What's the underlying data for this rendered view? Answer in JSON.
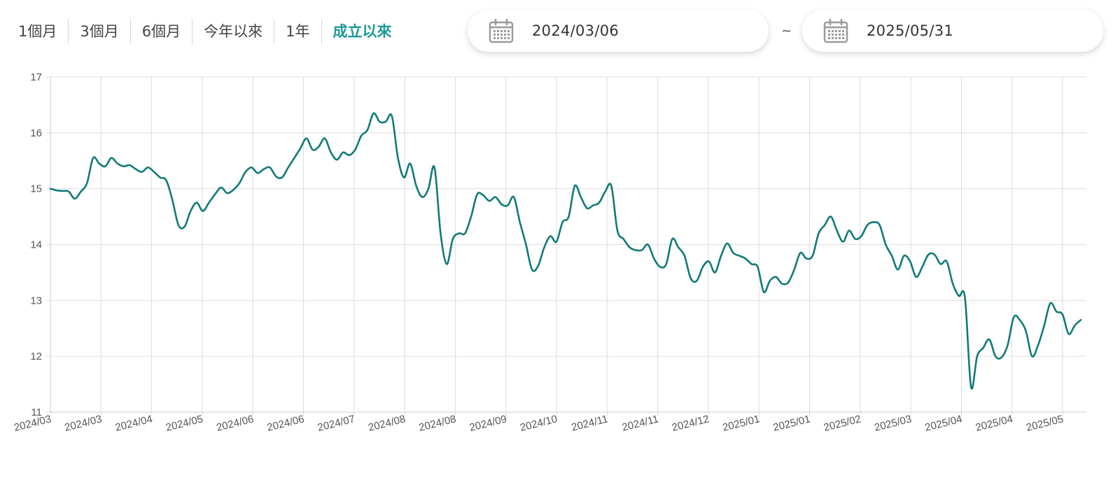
{
  "range_tabs": [
    {
      "label": "1個月",
      "active": false
    },
    {
      "label": "3個月",
      "active": false
    },
    {
      "label": "6個月",
      "active": false
    },
    {
      "label": "今年以來",
      "active": false
    },
    {
      "label": "1年",
      "active": false
    },
    {
      "label": "成立以來",
      "active": true
    }
  ],
  "date_range": {
    "start": "2024/03/06",
    "separator": "~",
    "end": "2025/05/31",
    "icon": "calendar-icon"
  },
  "colors": {
    "accent": "#1a9a97",
    "line": "#117a78",
    "grid": "#dddddd",
    "axis_text": "#555555"
  },
  "chart_data": {
    "type": "line",
    "title": "",
    "xlabel": "",
    "ylabel": "",
    "ylim": [
      11,
      17
    ],
    "yticks": [
      11,
      12,
      13,
      14,
      15,
      16,
      17
    ],
    "grid": true,
    "xtick_labels": [
      "2024/03",
      "2024/03",
      "2024/04",
      "2024/05",
      "2024/06",
      "2024/06",
      "2024/07",
      "2024/08",
      "2024/08",
      "2024/09",
      "2024/10",
      "2024/11",
      "2024/11",
      "2024/12",
      "2025/01",
      "2025/01",
      "2025/02",
      "2025/03",
      "2025/04",
      "2025/04",
      "2025/05"
    ],
    "series": [
      {
        "values": [
          15.0,
          14.97,
          14.96,
          14.95,
          14.82,
          14.95,
          15.1,
          15.55,
          15.45,
          15.4,
          15.55,
          15.45,
          15.4,
          15.42,
          15.35,
          15.3,
          15.38,
          15.3,
          15.2,
          15.15,
          14.8,
          14.35,
          14.32,
          14.6,
          14.75,
          14.6,
          14.75,
          14.9,
          15.02,
          14.92,
          14.98,
          15.1,
          15.3,
          15.38,
          15.28,
          15.35,
          15.38,
          15.22,
          15.2,
          15.38,
          15.55,
          15.72,
          15.9,
          15.7,
          15.75,
          15.9,
          15.65,
          15.52,
          15.65,
          15.6,
          15.7,
          15.95,
          16.05,
          16.35,
          16.2,
          16.2,
          16.3,
          15.55,
          15.2,
          15.45,
          15.05,
          14.85,
          15.0,
          15.38,
          14.2,
          13.65,
          14.1,
          14.2,
          14.2,
          14.5,
          14.9,
          14.88,
          14.78,
          14.85,
          14.72,
          14.7,
          14.85,
          14.4,
          14.0,
          13.55,
          13.62,
          13.95,
          14.15,
          14.05,
          14.4,
          14.5,
          15.05,
          14.85,
          14.65,
          14.7,
          14.75,
          14.95,
          15.05,
          14.25,
          14.1,
          13.95,
          13.9,
          13.9,
          14.0,
          13.75,
          13.6,
          13.65,
          14.1,
          13.95,
          13.8,
          13.4,
          13.35,
          13.6,
          13.7,
          13.5,
          13.8,
          14.02,
          13.85,
          13.8,
          13.75,
          13.65,
          13.6,
          13.15,
          13.35,
          13.42,
          13.3,
          13.32,
          13.55,
          13.85,
          13.75,
          13.8,
          14.2,
          14.35,
          14.5,
          14.25,
          14.05,
          14.25,
          14.1,
          14.15,
          14.35,
          14.4,
          14.35,
          14.0,
          13.8,
          13.55,
          13.8,
          13.7,
          13.42,
          13.6,
          13.82,
          13.82,
          13.65,
          13.7,
          13.3,
          13.08,
          13.05,
          11.45,
          12.0,
          12.15,
          12.3,
          12.0,
          11.98,
          12.2,
          12.7,
          12.65,
          12.45,
          12.0,
          12.2,
          12.55,
          12.95,
          12.8,
          12.75,
          12.4,
          12.55,
          12.65
        ]
      }
    ]
  }
}
